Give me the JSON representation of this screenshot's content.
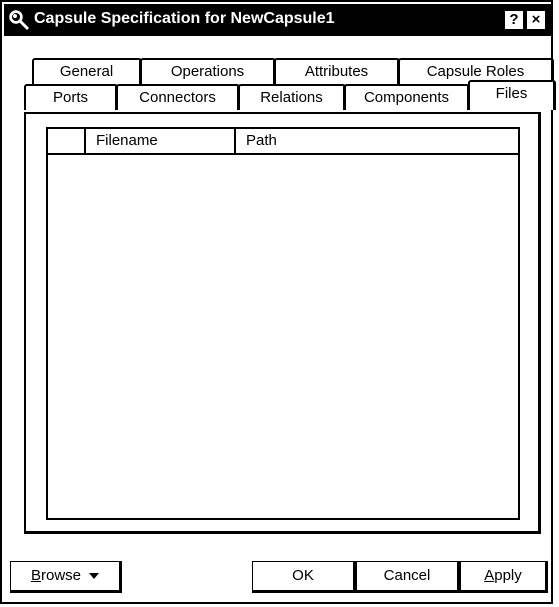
{
  "window": {
    "title": "Capsule Specification for NewCapsule1",
    "help_label": "?",
    "close_label": "×"
  },
  "tabs": {
    "row_back": [
      "General",
      "Operations",
      "Attributes",
      "Capsule Roles"
    ],
    "row_front": [
      "Ports",
      "Connectors",
      "Relations",
      "Components",
      "Files"
    ],
    "active": "Files"
  },
  "files_list": {
    "columns": [
      "",
      "Filename",
      "Path"
    ],
    "rows": []
  },
  "buttons": {
    "browse": {
      "label_first": "B",
      "label_rest": "rowse"
    },
    "ok": "OK",
    "cancel": "Cancel",
    "apply": {
      "label_first": "A",
      "label_rest": "pply"
    }
  },
  "icons": {
    "title": "magnifier-icon",
    "browse_dropdown": "triangle-down-icon"
  }
}
